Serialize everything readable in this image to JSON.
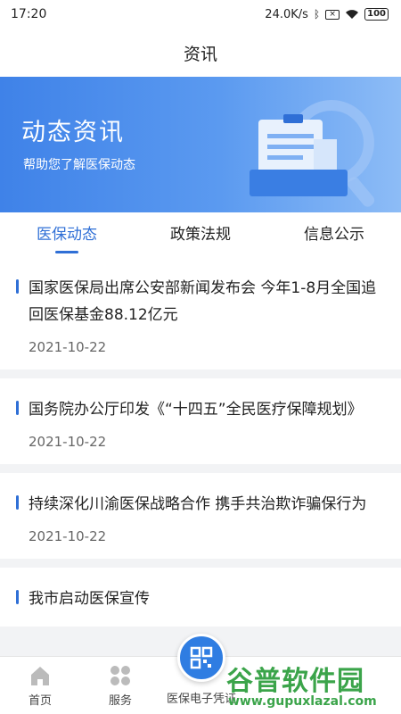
{
  "status": {
    "time": "17:20",
    "speed": "24.0K/s",
    "battery": "100"
  },
  "header": {
    "title": "资讯"
  },
  "banner": {
    "title": "动态资讯",
    "subtitle": "帮助您了解医保动态"
  },
  "tabs": [
    {
      "label": "医保动态",
      "active": true
    },
    {
      "label": "政策法规",
      "active": false
    },
    {
      "label": "信息公示",
      "active": false
    }
  ],
  "news": [
    {
      "title": "国家医保局出席公安部新闻发布会 今年1-8月全国追回医保基金88.12亿元",
      "date": "2021-10-22"
    },
    {
      "title": "国务院办公厅印发《“十四五”全民医疗保障规划》",
      "date": "2021-10-22"
    },
    {
      "title": "持续深化川渝医保战略合作 携手共治欺诈骗保行为",
      "date": "2021-10-22"
    },
    {
      "title": "我市启动医保宣传",
      "date": ""
    }
  ],
  "bottom_nav": {
    "home": "首页",
    "service": "服务",
    "card": "医保电子凭证"
  },
  "watermark": {
    "main": "谷普软件园",
    "url": "www.gupuxlazal.com"
  },
  "colors": {
    "accent": "#2f6fd6",
    "banner": "#4a8aea"
  }
}
